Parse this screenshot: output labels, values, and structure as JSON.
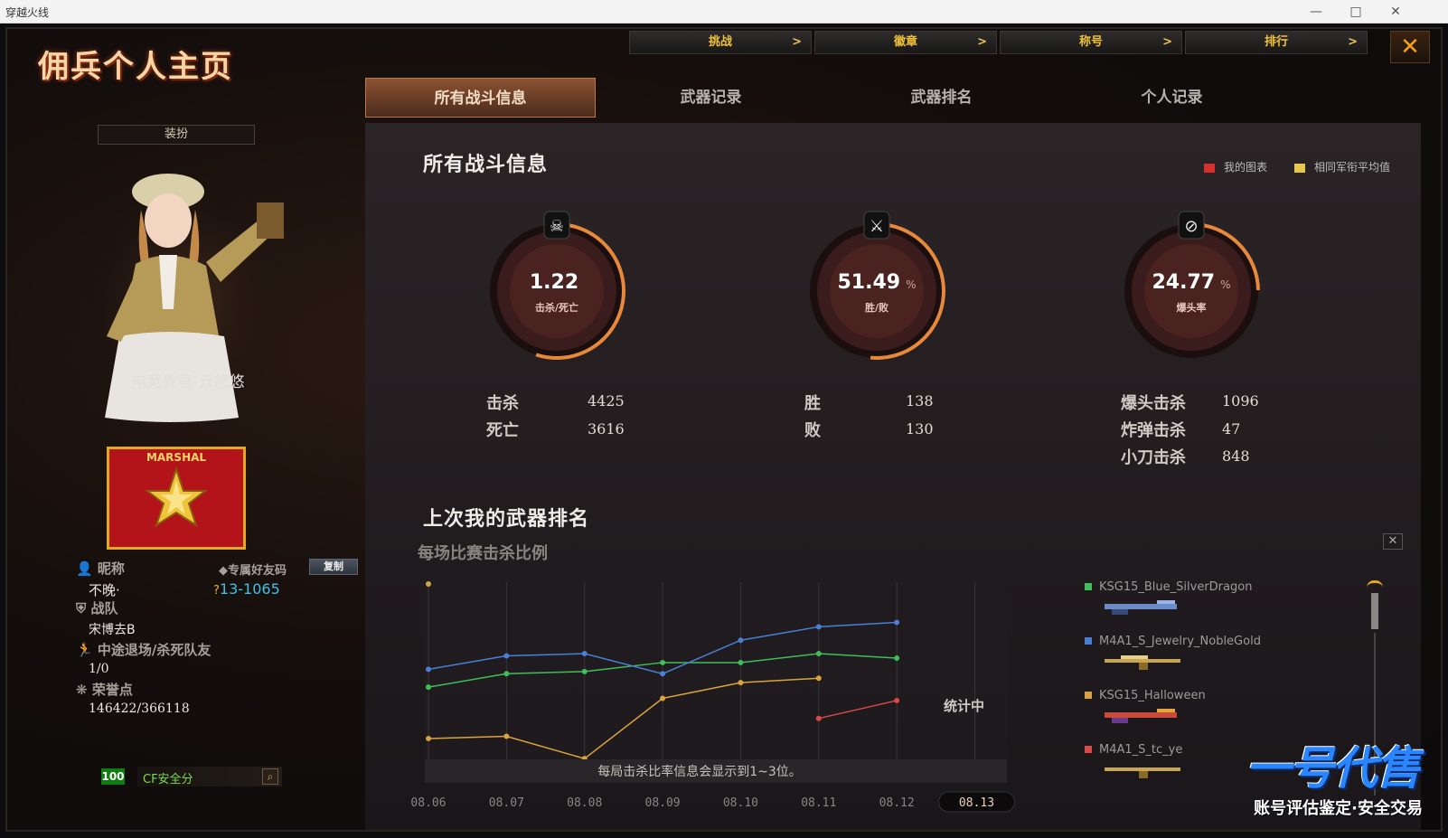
{
  "os_window": {
    "title": "穿越火线",
    "min": "—",
    "max": "□",
    "close": "✕"
  },
  "app": {
    "title": "佣兵个人主页",
    "close": "✕"
  },
  "topnav": [
    {
      "label": "挑战",
      "arrow": ">"
    },
    {
      "label": "徽章",
      "arrow": ">"
    },
    {
      "label": "称号",
      "arrow": ">"
    },
    {
      "label": "排行",
      "arrow": ">"
    }
  ],
  "tabs": [
    {
      "label": "所有战斗信息",
      "active": true
    },
    {
      "label": "武器记录",
      "active": false
    },
    {
      "label": "武器排名",
      "active": false
    },
    {
      "label": "个人记录",
      "active": false
    }
  ],
  "profile": {
    "outfit_button": "装扮",
    "character_name": "电竞教官-云悠悠",
    "rank_label": "MARSHAL",
    "nickname_label": "昵称",
    "nickname": "不晚·",
    "friend_code_label": "专属好友码",
    "friend_code": "13-1065",
    "copy_button": "复制",
    "team_label": "战队",
    "team": "宋博去B",
    "quit_label": "中途退场/杀死队友",
    "quit_value": "1/0",
    "honor_label": "荣誉点",
    "honor_value": "146422/366118",
    "safety_score": "100",
    "safety_label": "CF安全分"
  },
  "battle": {
    "title": "所有战斗信息",
    "legend": [
      {
        "label": "我的图表",
        "color": "#d8312c"
      },
      {
        "label": "相同军衔平均值",
        "color": "#e8c84a"
      }
    ],
    "gauges": [
      {
        "value": "1.22",
        "unit": "",
        "label": "击杀/死亡",
        "fraction": 0.55
      },
      {
        "value": "51.49",
        "unit": "%",
        "label": "胜/败",
        "fraction": 0.5149
      },
      {
        "value": "24.77",
        "unit": "%",
        "label": "爆头率",
        "fraction": 0.2477
      }
    ],
    "stats": {
      "kills_label": "击杀",
      "kills": "4425",
      "deaths_label": "死亡",
      "deaths": "3616",
      "wins_label": "胜",
      "wins": "138",
      "losses_label": "败",
      "losses": "130",
      "headshot_label": "爆头击杀",
      "headshot": "1096",
      "bomb_label": "炸弹击杀",
      "bomb": "47",
      "knife_label": "小刀击杀",
      "knife": "848"
    }
  },
  "weapon_rank": {
    "title": "上次我的武器排名",
    "subtitle": "每场比赛击杀比例",
    "status_text": "统计中",
    "note": "每局击杀比率信息会显示到1~3位。",
    "weapons": [
      {
        "name": "KSG15_Blue_SilverDragon",
        "color": "#3fbf5a"
      },
      {
        "name": "M4A1_S_Jewelry_NobleGold",
        "color": "#4a7fd6"
      },
      {
        "name": "KSG15_Halloween",
        "color": "#d9a43e"
      },
      {
        "name": "M4A1_S_tc_ye",
        "color": "#d84a4a"
      }
    ]
  },
  "watermark": {
    "brand": "一号代售",
    "tagline": "账号评估鉴定·安全交易"
  },
  "chart_data": {
    "type": "line",
    "x": [
      "08.06",
      "08.07",
      "08.08",
      "08.09",
      "08.10",
      "08.11",
      "08.12",
      "08.13"
    ],
    "series": [
      {
        "name": "KSG15_Blue_SilverDragon",
        "values": [
          0.38,
          0.44,
          0.45,
          0.49,
          0.49,
          0.53,
          0.51,
          null
        ]
      },
      {
        "name": "M4A1_S_Jewelry_NobleGold",
        "values": [
          0.46,
          0.52,
          0.53,
          0.44,
          0.59,
          0.65,
          0.67,
          null
        ]
      },
      {
        "name": "KSG15_Halloween",
        "values": [
          0.15,
          0.16,
          0.06,
          0.33,
          0.4,
          0.42,
          null,
          null
        ]
      },
      {
        "name": "M4A1_S_tc_ye",
        "values": [
          null,
          null,
          null,
          null,
          null,
          0.24,
          0.32,
          null
        ]
      }
    ],
    "selected_x": "08.13",
    "colors": [
      "#3fbf5a",
      "#4a7fd6",
      "#d9a43e",
      "#d84a4a"
    ]
  }
}
